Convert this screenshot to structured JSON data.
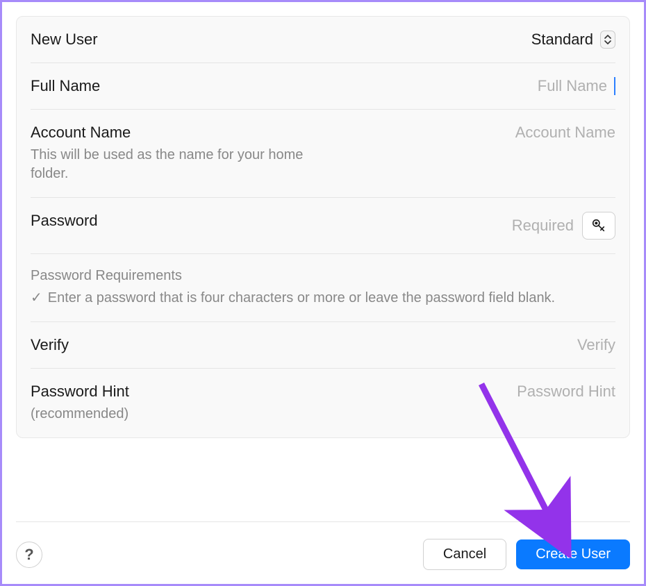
{
  "form": {
    "new_user": {
      "label": "New User",
      "selected": "Standard"
    },
    "full_name": {
      "label": "Full Name",
      "placeholder": "Full Name",
      "value": ""
    },
    "account_name": {
      "label": "Account Name",
      "sublabel": "This will be used as the name for your home folder.",
      "placeholder": "Account Name",
      "value": ""
    },
    "password": {
      "label": "Password",
      "placeholder": "Required",
      "value": ""
    },
    "requirements": {
      "title": "Password Requirements",
      "text": "Enter a password that is four characters or more or leave the password field blank."
    },
    "verify": {
      "label": "Verify",
      "placeholder": "Verify",
      "value": ""
    },
    "password_hint": {
      "label": "Password Hint",
      "sublabel": "(recommended)",
      "placeholder": "Password Hint",
      "value": ""
    }
  },
  "footer": {
    "help": "?",
    "cancel": "Cancel",
    "create": "Create User"
  },
  "colors": {
    "accent": "#0a7aff",
    "border_highlight": "#a78bfa"
  }
}
